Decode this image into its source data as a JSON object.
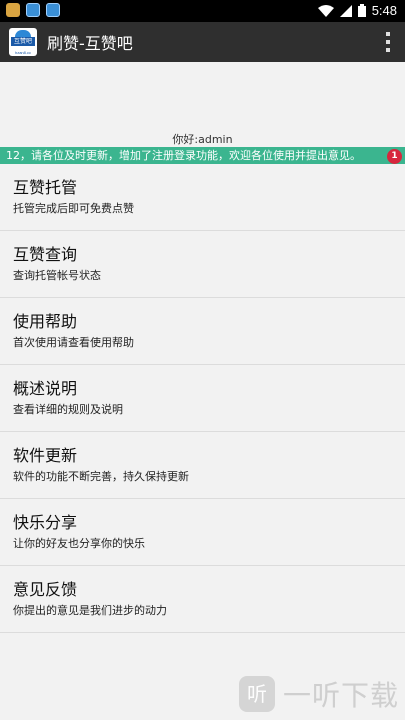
{
  "statusbar": {
    "time": "5:48"
  },
  "appbar": {
    "title": "刷赞-互赞吧",
    "logo_text": "互赞吧",
    "logo_sub": "hzan8.cc"
  },
  "greeting": "你好:admin",
  "notice": {
    "text": "12，请各位及时更新，增加了注册登录功能，欢迎各位使用并提出意见。",
    "badge": "1"
  },
  "menu": [
    {
      "title": "互赞托管",
      "desc": "托管完成后即可免费点赞"
    },
    {
      "title": "互赞查询",
      "desc": "查询托管帐号状态"
    },
    {
      "title": "使用帮助",
      "desc": "首次使用请查看使用帮助"
    },
    {
      "title": "概述说明",
      "desc": "查看详细的规则及说明"
    },
    {
      "title": "软件更新",
      "desc": "软件的功能不断完善，持久保持更新"
    },
    {
      "title": "快乐分享",
      "desc": "让你的好友也分享你的快乐"
    },
    {
      "title": "意见反馈",
      "desc": "你提出的意见是我们进步的动力"
    }
  ],
  "watermark": {
    "icon": "听",
    "text": "一听下载"
  }
}
